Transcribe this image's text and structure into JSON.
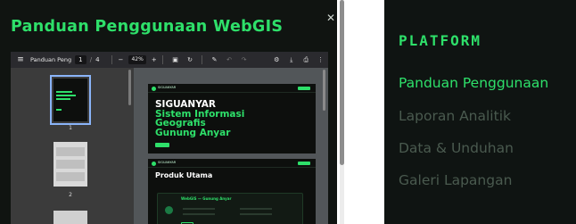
{
  "modal": {
    "title": "Panduan Penggunaan WebGIS",
    "close_icon": "close-icon"
  },
  "pdf_viewer": {
    "file_name": "Panduan Pengg...",
    "current_page": "1",
    "page_separator": "/",
    "total_pages": "4",
    "zoom": "42%",
    "zoom_out": "−",
    "zoom_in": "+",
    "thumbnails": [
      {
        "number": "1",
        "selected": true
      },
      {
        "number": "2",
        "selected": false
      }
    ],
    "pages": [
      {
        "brand": "SIGUANYAR",
        "hero_line1": "SIGUANYAR",
        "hero_line2": "Sistem Informasi",
        "hero_line3": "Geografis",
        "hero_line4": "Gunung Anyar"
      },
      {
        "brand": "SIGUANYAR",
        "title": "Produk Utama",
        "card_title": "WebGIS — Gunung Anyar"
      }
    ],
    "icons": [
      "menu-icon",
      "fit-page-icon",
      "rotate-icon",
      "draw-icon",
      "undo-icon",
      "redo-icon",
      "annotate-icon",
      "download-icon",
      "print-icon",
      "more-icon"
    ]
  },
  "platform": {
    "heading": "PLATFORM",
    "links": [
      {
        "label": "Panduan Penggunaan",
        "active": true
      },
      {
        "label": "Laporan Analitik",
        "active": false
      },
      {
        "label": "Data & Unduhan",
        "active": false
      },
      {
        "label": "Galeri Lapangan",
        "active": false
      }
    ]
  },
  "colors": {
    "accent": "#2ee06a",
    "background": "#101411",
    "muted_link": "#4a5a4f"
  }
}
